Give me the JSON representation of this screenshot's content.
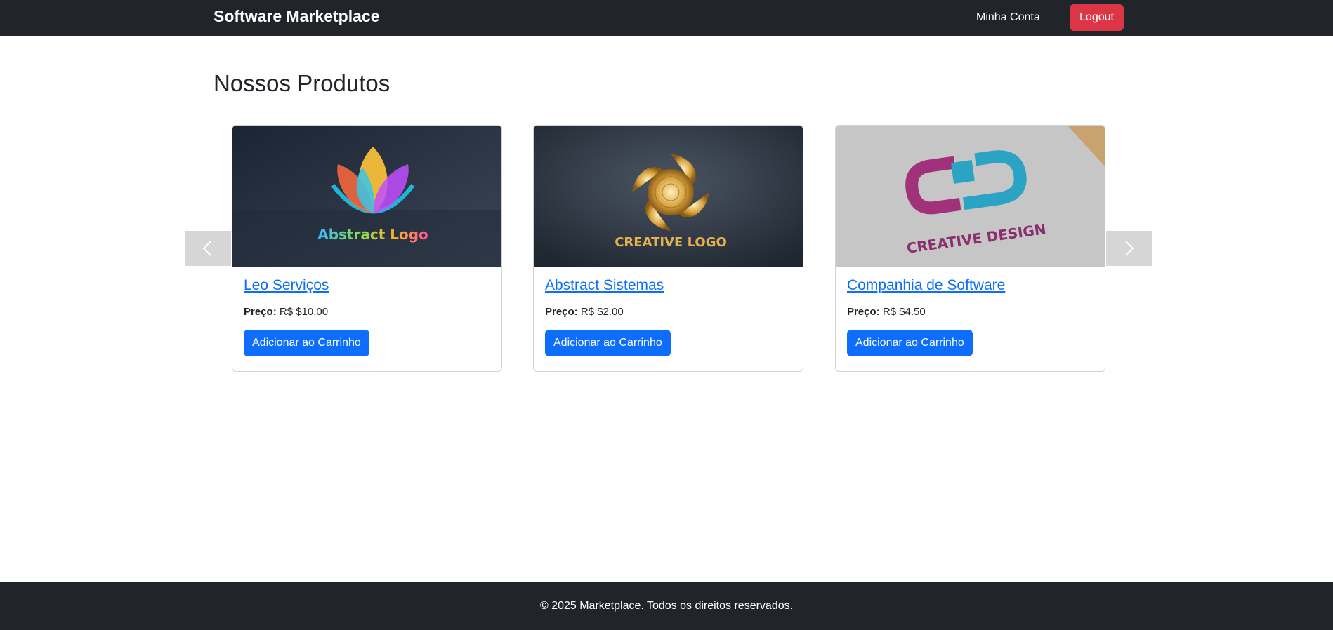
{
  "navbar": {
    "brand": "Software Marketplace",
    "account_link": "Minha Conta",
    "logout_label": "Logout"
  },
  "main": {
    "title": "Nossos Produtos"
  },
  "products": [
    {
      "name": "Leo Serviços",
      "price_label": "Preço:",
      "price": "R$ $10.00",
      "button": "Adicionar ao Carrinho",
      "image_text": "Abstract Logo"
    },
    {
      "name": "Abstract Sistemas",
      "price_label": "Preço:",
      "price": "R$ $2.00",
      "button": "Adicionar ao Carrinho",
      "image_text": "CREATIVE LOGO"
    },
    {
      "name": "Companhia de Software",
      "price_label": "Preço:",
      "price": "R$ $4.50",
      "button": "Adicionar ao Carrinho",
      "image_text": "CREATIVE DESIGN"
    }
  ],
  "carousel": {
    "prev_icon": "chevron-left-icon",
    "next_icon": "chevron-right-icon"
  },
  "footer": {
    "text": "© 2025 Marketplace. Todos os direitos reservados."
  },
  "colors": {
    "navbar_bg": "#212529",
    "primary": "#0d6efd",
    "danger": "#dc3545"
  }
}
